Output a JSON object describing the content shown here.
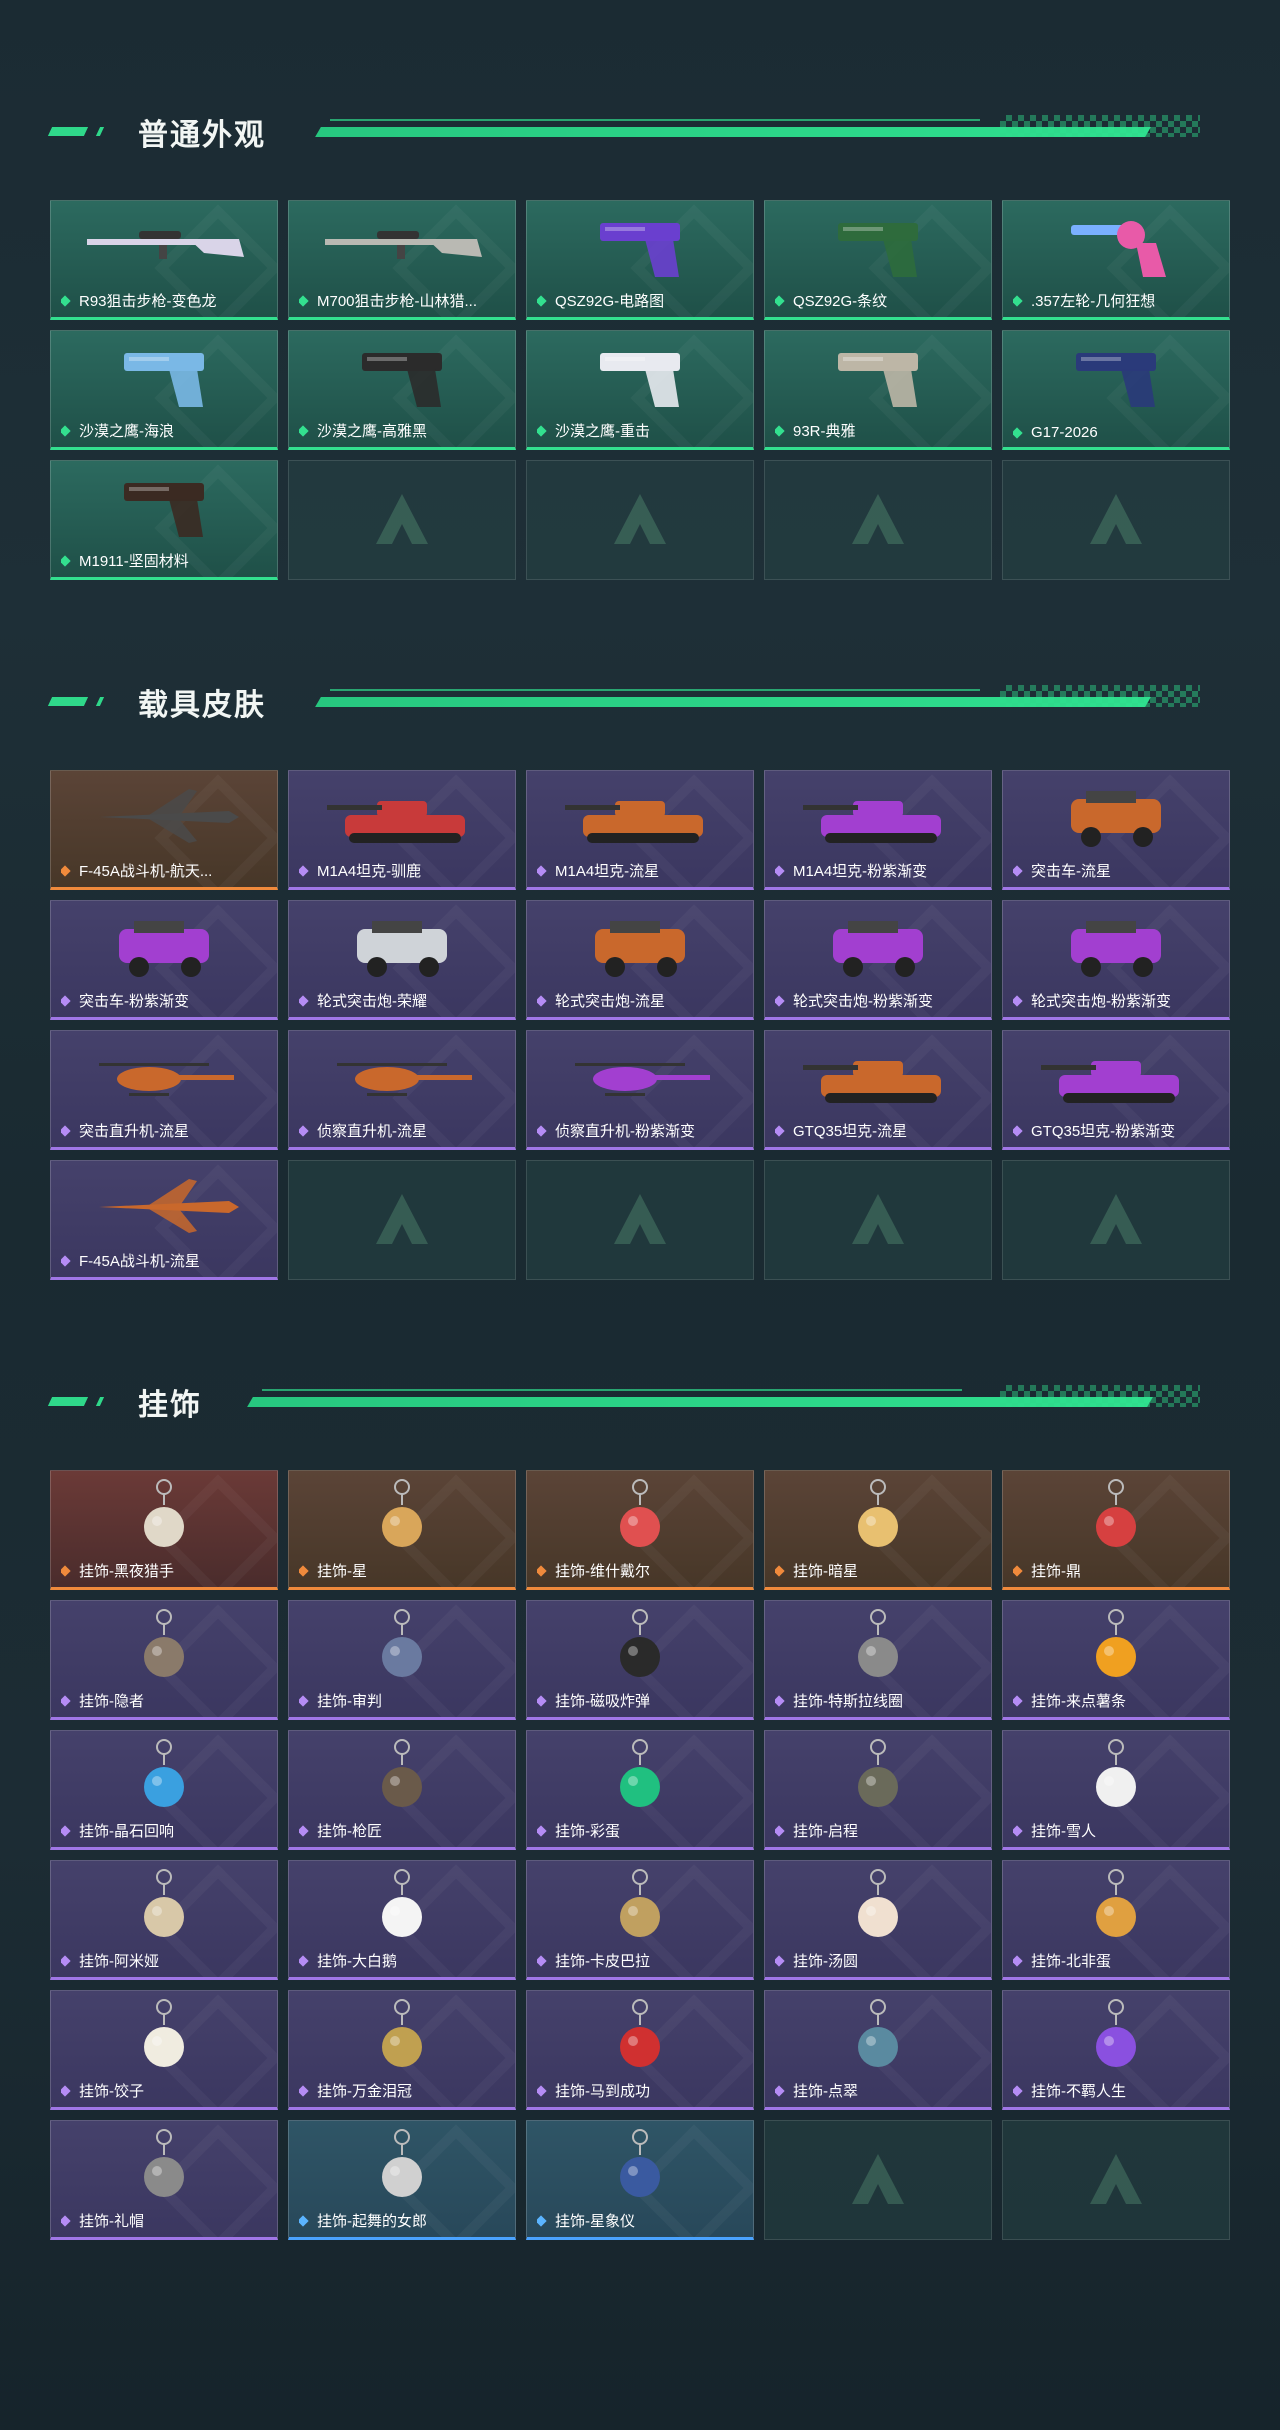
{
  "sections": [
    {
      "title": "普通外观",
      "theme": "green",
      "items": [
        {
          "label": "R93狙击步枪-变色龙",
          "icon": "sniper-rifle-icon",
          "color": "#d9d4e8"
        },
        {
          "label": "M700狙击步枪-山林猎...",
          "icon": "sniper-rifle-icon",
          "color": "#b9b9b3"
        },
        {
          "label": "QSZ92G-电路图",
          "icon": "pistol-icon",
          "color": "#6a3fcf"
        },
        {
          "label": "QSZ92G-条纹",
          "icon": "pistol-icon",
          "color": "#2e6b3c"
        },
        {
          "label": ".357左轮-几何狂想",
          "icon": "revolver-icon",
          "color": "#e85aa8"
        },
        {
          "label": "沙漠之鹰-海浪",
          "icon": "pistol-icon",
          "color": "#7ab8e6"
        },
        {
          "label": "沙漠之鹰-高雅黑",
          "icon": "pistol-icon",
          "color": "#2b2b2b"
        },
        {
          "label": "沙漠之鹰-重击",
          "icon": "pistol-icon",
          "color": "#e8eaf0"
        },
        {
          "label": "93R-典雅",
          "icon": "pistol-icon",
          "color": "#bdb6a6"
        },
        {
          "label": "G17-2026",
          "icon": "pistol-icon",
          "color": "#2a3a7a"
        },
        {
          "label": "M1911-坚固材料",
          "icon": "pistol-icon",
          "color": "#3b2a22"
        }
      ]
    },
    {
      "title": "载具皮肤",
      "theme": "purple",
      "items": [
        {
          "label": "F-45A战斗机-航天...",
          "icon": "jet-icon",
          "color": "#4a4a4a",
          "rarity": "orange"
        },
        {
          "label": "M1A4坦克-驯鹿",
          "icon": "tank-icon",
          "color": "#c83a3a"
        },
        {
          "label": "M1A4坦克-流星",
          "icon": "tank-icon",
          "color": "#c9682c"
        },
        {
          "label": "M1A4坦克-粉紫渐变",
          "icon": "tank-icon",
          "color": "#a23fd0"
        },
        {
          "label": "突击车-流星",
          "icon": "assault-vehicle-icon",
          "color": "#c9682c"
        },
        {
          "label": "突击车-粉紫渐变",
          "icon": "assault-vehicle-icon",
          "color": "#a23fd0"
        },
        {
          "label": "轮式突击炮-荣耀",
          "icon": "assault-vehicle-icon",
          "color": "#cfd3d8"
        },
        {
          "label": "轮式突击炮-流星",
          "icon": "assault-vehicle-icon",
          "color": "#c9682c"
        },
        {
          "label": "轮式突击炮-粉紫渐变",
          "icon": "assault-vehicle-icon",
          "color": "#a23fd0"
        },
        {
          "label": "轮式突击炮-粉紫渐变",
          "icon": "assault-vehicle-icon",
          "color": "#a23fd0"
        },
        {
          "label": "突击直升机-流星",
          "icon": "helicopter-icon",
          "color": "#c9682c"
        },
        {
          "label": "侦察直升机-流星",
          "icon": "helicopter-icon",
          "color": "#c9682c"
        },
        {
          "label": "侦察直升机-粉紫渐变",
          "icon": "helicopter-icon",
          "color": "#a23fd0"
        },
        {
          "label": "GTQ35坦克-流星",
          "icon": "tank-icon",
          "color": "#c9682c"
        },
        {
          "label": "GTQ35坦克-粉紫渐变",
          "icon": "tank-icon",
          "color": "#a23fd0"
        },
        {
          "label": "F-45A战斗机-流星",
          "icon": "jet-icon",
          "color": "#c9682c"
        }
      ]
    },
    {
      "title": "挂饰",
      "theme": "purple",
      "items": [
        {
          "label": "挂饰-黑夜猎手",
          "icon": "charm-icon",
          "color": "#e0d8c8",
          "rarity": "red"
        },
        {
          "label": "挂饰-星",
          "icon": "charm-icon",
          "color": "#d9a65a",
          "rarity": "orange"
        },
        {
          "label": "挂饰-维什戴尔",
          "icon": "charm-icon",
          "color": "#e05050",
          "rarity": "orange"
        },
        {
          "label": "挂饰-暗星",
          "icon": "charm-icon",
          "color": "#e8c070",
          "rarity": "orange"
        },
        {
          "label": "挂饰-鼎",
          "icon": "charm-icon",
          "color": "#d64040",
          "rarity": "orange"
        },
        {
          "label": "挂饰-隐者",
          "icon": "charm-icon",
          "color": "#8a7a6a"
        },
        {
          "label": "挂饰-审判",
          "icon": "charm-icon",
          "color": "#6a7aa0"
        },
        {
          "label": "挂饰-磁吸炸弹",
          "icon": "charm-icon",
          "color": "#2a2a2a"
        },
        {
          "label": "挂饰-特斯拉线圈",
          "icon": "charm-icon",
          "color": "#8a8a8a"
        },
        {
          "label": "挂饰-来点薯条",
          "icon": "charm-icon",
          "color": "#f0a020"
        },
        {
          "label": "挂饰-晶石回响",
          "icon": "charm-icon",
          "color": "#3aa0e0"
        },
        {
          "label": "挂饰-枪匠",
          "icon": "charm-icon",
          "color": "#6a5a4a"
        },
        {
          "label": "挂饰-彩蛋",
          "icon": "charm-icon",
          "color": "#20c080"
        },
        {
          "label": "挂饰-启程",
          "icon": "charm-icon",
          "color": "#6a6a5a"
        },
        {
          "label": "挂饰-雪人",
          "icon": "charm-icon",
          "color": "#f0f0f0"
        },
        {
          "label": "挂饰-阿米娅",
          "icon": "charm-icon",
          "color": "#d8c8a8"
        },
        {
          "label": "挂饰-大白鹅",
          "icon": "charm-icon",
          "color": "#f4f4f4"
        },
        {
          "label": "挂饰-卡皮巴拉",
          "icon": "charm-icon",
          "color": "#c0a060"
        },
        {
          "label": "挂饰-汤圆",
          "icon": "charm-icon",
          "color": "#f0e0d0"
        },
        {
          "label": "挂饰-北非蛋",
          "icon": "charm-icon",
          "color": "#e0a040"
        },
        {
          "label": "挂饰-饺子",
          "icon": "charm-icon",
          "color": "#f0ece0"
        },
        {
          "label": "挂饰-万金泪冠",
          "icon": "charm-icon",
          "color": "#c0a050"
        },
        {
          "label": "挂饰-马到成功",
          "icon": "charm-icon",
          "color": "#d03030"
        },
        {
          "label": "挂饰-点翠",
          "icon": "charm-icon",
          "color": "#5a8aa0"
        },
        {
          "label": "挂饰-不羁人生",
          "icon": "charm-icon",
          "color": "#8a50e0"
        },
        {
          "label": "挂饰-礼帽",
          "icon": "charm-icon",
          "color": "#8a8a8a"
        },
        {
          "label": "挂饰-起舞的女郎",
          "icon": "charm-icon",
          "color": "#d0d0d0",
          "rarity": "blue"
        },
        {
          "label": "挂饰-星象仪",
          "icon": "charm-icon",
          "color": "#3a5aa0",
          "rarity": "blue"
        }
      ]
    }
  ]
}
